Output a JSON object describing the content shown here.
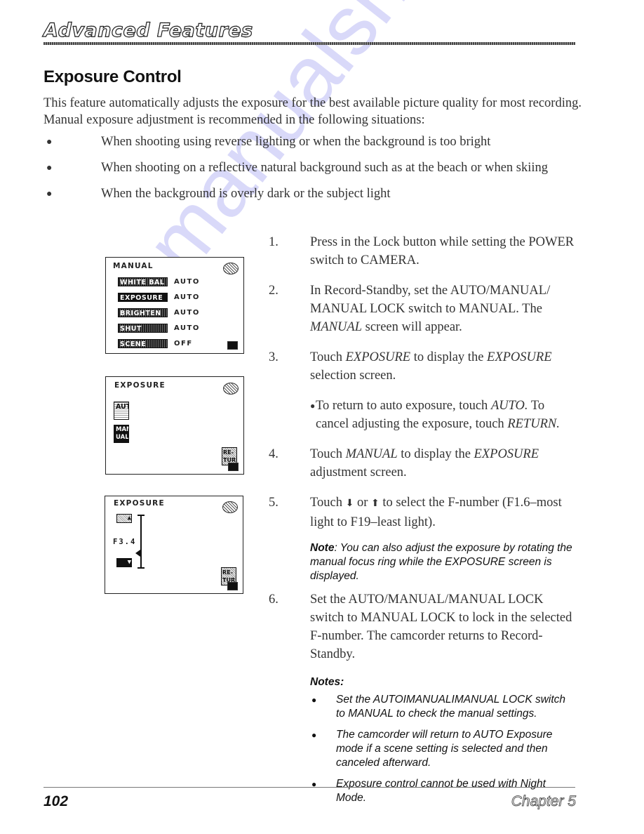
{
  "header": {
    "title": "Advanced Features"
  },
  "section": {
    "title": "Exposure Control"
  },
  "intro": "This feature automatically adjusts the exposure for the best available picture quality for most recording. Manual exposure adjustment is recommended in the following situations:",
  "situations": [
    "When shooting using reverse lighting or when the background is too bright",
    "When shooting on a reflective natural background such as at the beach or when skiing",
    "When the background is overly dark or the subject light"
  ],
  "screens": {
    "manual": {
      "title": "MANUAL",
      "items": [
        {
          "label": "WHITE BAL",
          "value": "AUTO"
        },
        {
          "label": "EXPOSURE",
          "value": "AUTO"
        },
        {
          "label": "BRIGHTEN",
          "value": "AUTO"
        },
        {
          "label": "SHUT SPEED",
          "value": "AUTO"
        },
        {
          "label": "SCENE MENU",
          "value": "OFF"
        }
      ]
    },
    "exposure_select": {
      "title": "EXPOSURE",
      "auto_label": "AUTO",
      "manual_label": "MAN-UAL",
      "return_label": "RE-TURN"
    },
    "exposure_adjust": {
      "title": "EXPOSURE",
      "fnumber": "F3.4",
      "return_label": "RE-TURN"
    }
  },
  "steps": [
    {
      "num": "1.",
      "text": "Press in the Lock button while setting the POWER switch to CAMERA."
    },
    {
      "num": "2.",
      "text_a": "In Record-Standby, set the AUTO/MANUAL/ MANUAL LOCK switch to MANUAL. The ",
      "em": "MANUAL",
      "text_b": " screen will appear."
    },
    {
      "num": "3.",
      "text_a": "Touch ",
      "em1": "EXPOSURE",
      "text_b": " to display the ",
      "em2": "EXPOSURE",
      "text_c": " selection screen."
    },
    {
      "num": "4.",
      "text_a": "Touch ",
      "em1": "MANUAL",
      "text_b": " to display the ",
      "em2": "EXPOSURE",
      "text_c": " adjustment screen."
    },
    {
      "num": "5.",
      "text_a": "Touch ",
      "text_b": " or ",
      "text_c": " to select the F-number (F1.6–most light to F19–least light)."
    },
    {
      "num": "6.",
      "text": "Set the AUTO/MANUAL/MANUAL LOCK switch to MANUAL LOCK to lock in the selected F-number. The camcorder returns to Record-Standby."
    }
  ],
  "step3_sub": {
    "a": "To return to auto exposure, touch ",
    "em1": "AUTO.",
    "b": " To cancel adjusting the exposure, touch ",
    "em2": "RETURN."
  },
  "note": {
    "label": "Note",
    "text": ": You can also adjust the exposure by rotating the manual focus ring while the EXPOSURE screen is displayed."
  },
  "notes": {
    "label": "Notes:",
    "items": [
      "Set the AUTOIMANUALIMANUAL LOCK switch to MANUAL to check the manual settings.",
      "The camcorder will return to AUTO Exposure mode if a scene setting is selected and then canceled afterward.",
      "Exposure control cannot be used with Night Mode."
    ]
  },
  "footer": {
    "page": "102",
    "chapter": "Chapter 5"
  },
  "watermark": "manualshive.com"
}
